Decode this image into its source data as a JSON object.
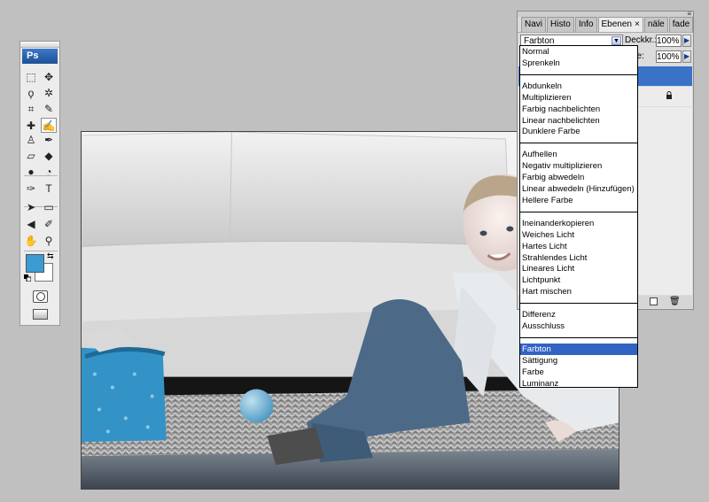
{
  "toolbox": {
    "logo": "Ps",
    "tools": [
      {
        "name": "marquee-tool",
        "glyph": "⬚"
      },
      {
        "name": "move-tool",
        "glyph": "✥"
      },
      {
        "name": "lasso-tool",
        "glyph": "ϙ"
      },
      {
        "name": "magic-wand-tool",
        "glyph": "✲"
      },
      {
        "name": "crop-tool",
        "glyph": "⌗"
      },
      {
        "name": "slice-tool",
        "glyph": "✎"
      },
      {
        "name": "healing-brush-tool",
        "glyph": "✚"
      },
      {
        "name": "brush-tool",
        "glyph": "✍"
      },
      {
        "name": "clone-stamp-tool",
        "glyph": "♙"
      },
      {
        "name": "history-brush-tool",
        "glyph": "✒"
      },
      {
        "name": "eraser-tool",
        "glyph": "▱"
      },
      {
        "name": "paint-bucket-tool",
        "glyph": "◆"
      },
      {
        "name": "blur-tool",
        "glyph": "●"
      },
      {
        "name": "dodge-tool",
        "glyph": "◔"
      },
      {
        "name": "pen-tool",
        "glyph": "✑"
      },
      {
        "name": "type-tool",
        "glyph": "T"
      },
      {
        "name": "path-selection-tool",
        "glyph": "➤"
      },
      {
        "name": "shape-tool",
        "glyph": "▭"
      },
      {
        "name": "notes-tool",
        "glyph": "◀"
      },
      {
        "name": "eyedropper-tool",
        "glyph": "✐"
      },
      {
        "name": "hand-tool",
        "glyph": "✋"
      },
      {
        "name": "zoom-tool",
        "glyph": "⚲"
      }
    ],
    "foreground_color": "#3b9bd3",
    "background_color": "#ffffff"
  },
  "layers_panel": {
    "tabs": [
      {
        "label": "Navi",
        "active": false
      },
      {
        "label": "Histo",
        "active": false
      },
      {
        "label": "Info",
        "active": false
      },
      {
        "label": "Ebenen",
        "active": true
      },
      {
        "label": "näle",
        "active": false
      },
      {
        "label": "fade",
        "active": false
      }
    ],
    "tab_close": "×",
    "blend_mode": "Farbton",
    "opacity_label": "Deckkr.:",
    "opacity_value": "100%",
    "fill_label": "che:",
    "fill_value": "100%"
  },
  "blend_dropdown": {
    "selected": "Farbton",
    "groups": [
      [
        "Normal",
        "Sprenkeln"
      ],
      [
        "Abdunkeln",
        "Multiplizieren",
        "Farbig nachbelichten",
        "Linear nachbelichten",
        "Dunklere Farbe"
      ],
      [
        "Aufhellen",
        "Negativ multiplizieren",
        "Farbig abwedeln",
        "Linear abwedeln (Hinzufügen)",
        "Hellere Farbe"
      ],
      [
        "Ineinanderkopieren",
        "Weiches Licht",
        "Hartes Licht",
        "Strahlendes Licht",
        "Lineares Licht",
        "Lichtpunkt",
        "Hart mischen"
      ],
      [
        "Differenz",
        "Ausschluss"
      ],
      [
        "Farbton",
        "Sättigung",
        "Farbe",
        "Luminanz"
      ]
    ]
  },
  "colors": {
    "workspace": "#c0c0c0",
    "selection": "#3163c5",
    "layer_selected": "#3972c7",
    "accent_blue": "#3b9bd3"
  }
}
